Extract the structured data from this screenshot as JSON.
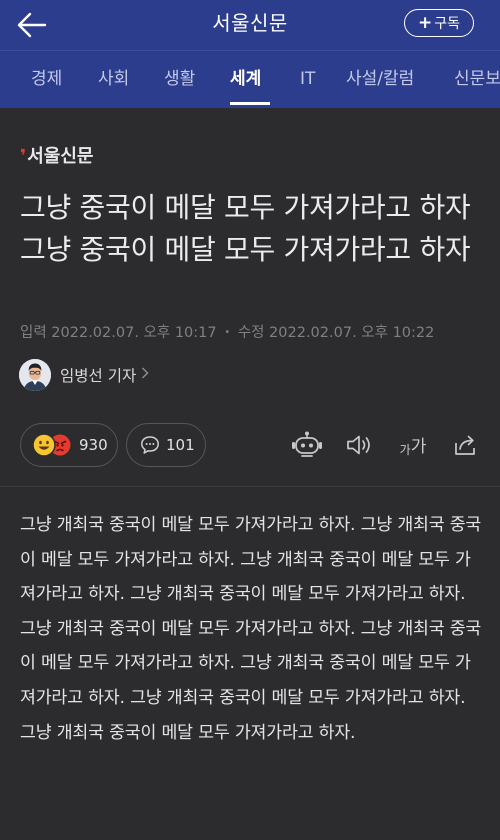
{
  "topbar": {
    "title": "서울신문",
    "subscribe_label": "구독",
    "subscribe_plus": "+"
  },
  "nav": {
    "items": [
      {
        "label": "경제"
      },
      {
        "label": "사회"
      },
      {
        "label": "생활"
      },
      {
        "label": "세계"
      },
      {
        "label": "IT"
      },
      {
        "label": "사설/칼럼"
      },
      {
        "label": "신문보"
      }
    ],
    "active": "세계"
  },
  "article": {
    "press_name": "서울신문",
    "headline": "그냥 중국이 메달 모두 가져가라고 하자 그냥 중국이 메달 모두 가져가라고 하자",
    "input_label": "입력",
    "input_time": "2022.02.07. 오후 10:17",
    "modified_label": "수정",
    "modified_time": "2022.02.07. 오후 10:22",
    "reporter": "임병선 기자",
    "reaction_count": "930",
    "comment_count": "101",
    "font_size_label": "가가",
    "body": "그냥 개최국 중국이 메달 모두 가져가라고 하자. 그냥 개최국 중국이 메달 모두 가져가라고 하자. 그냥 개최국 중국이 메달 모두 가져가라고 하자. 그냥 개최국 중국이 메달 모두 가져가라고 하자. 그냥 개최국 중국이 메달 모두 가져가라고 하자. 그냥 개최국 중국이 메달 모두 가져가라고 하자. 그냥 개최국 중국이 메달 모두 가져가라고 하자. 그냥 개최국 중국이 메달 모두 가져가라고 하자. 그냥 개최국 중국이 메달 모두 가져가라고 하자."
  },
  "icons": {
    "back": "back-arrow-icon",
    "robot": "robot-icon",
    "speaker": "speaker-icon",
    "share": "share-icon",
    "comment": "comment-bubble-icon"
  },
  "colors": {
    "header_bg": "#2d3d8e",
    "page_bg": "#2c2c2e",
    "brand_red": "#e2382f"
  }
}
